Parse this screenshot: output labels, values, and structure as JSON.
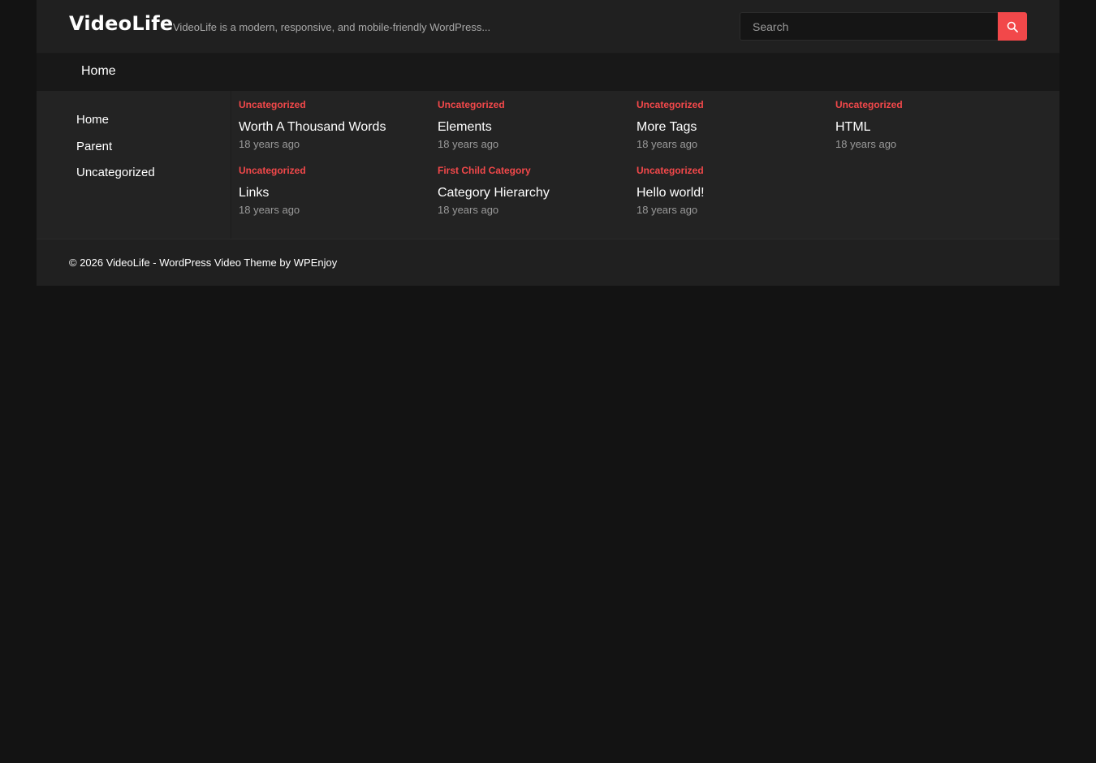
{
  "header": {
    "site_title": "VideoLife",
    "site_description": "VideoLife is a modern, responsive, and mobile-friendly WordPress...",
    "search_placeholder": "Search",
    "search_icon": "search-icon"
  },
  "nav": {
    "items": [
      {
        "label": "Home"
      }
    ]
  },
  "sidebar": {
    "items": [
      {
        "label": "Home"
      },
      {
        "label": "Parent"
      },
      {
        "label": "Uncategorized"
      }
    ]
  },
  "posts": [
    {
      "category": "Uncategorized",
      "title": "Worth A Thousand Words",
      "date": "18 years ago"
    },
    {
      "category": "Uncategorized",
      "title": "Elements",
      "date": "18 years ago"
    },
    {
      "category": "Uncategorized",
      "title": "More Tags",
      "date": "18 years ago"
    },
    {
      "category": "Uncategorized",
      "title": "HTML",
      "date": "18 years ago"
    },
    {
      "category": "Uncategorized",
      "title": "Links",
      "date": "18 years ago"
    },
    {
      "category": "First Child Category",
      "title": "Category Hierarchy",
      "date": "18 years ago"
    },
    {
      "category": "Uncategorized",
      "title": "Hello world!",
      "date": "18 years ago"
    }
  ],
  "footer": {
    "copyright_prefix": "© 2026 VideoLife - ",
    "theme_link": "WordPress Video Theme",
    "by_text": " by ",
    "author_link": "WPEnjoy"
  },
  "colors": {
    "accent": "#f2484a",
    "background": "#131313",
    "panel": "#232323",
    "header": "#202020"
  }
}
